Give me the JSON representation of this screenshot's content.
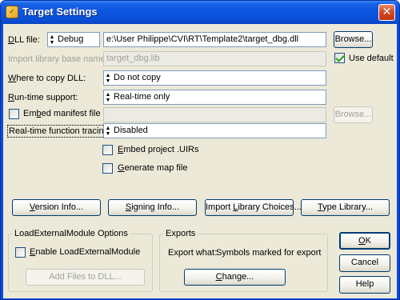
{
  "window": {
    "title": "Target Settings",
    "icon": "cvi-app-icon",
    "close_glyph": "✕",
    "colors": {
      "titlebar": "#0a55e0",
      "client": "#ece9d8",
      "check": "#21a121"
    }
  },
  "dll_file": {
    "label_prefix": "D",
    "label_rest": "LL file:",
    "config_value": "Debug",
    "path_value": "e:\\User Philippe\\CVI\\RT\\Template2\\target_dbg.dll",
    "browse_label": "Browse..."
  },
  "import_library": {
    "label": "Import library base name:",
    "value": "target_dbg.lib",
    "use_default_label": "Use default",
    "use_default_checked": true
  },
  "where_to_copy": {
    "label_prefix": "W",
    "label_rest": "here to copy DLL:",
    "value": "Do not copy"
  },
  "runtime_support": {
    "label_prefix": "R",
    "label_rest": "un-time support:",
    "value": "Real-time only"
  },
  "embed_manifest": {
    "label_pre": "Em",
    "label_u": "b",
    "label_post": "ed manifest file",
    "checked": false,
    "path_value": "",
    "browse_label": "Browse..."
  },
  "function_tracing": {
    "label": "Real-time function tracing:",
    "value": "Disabled"
  },
  "embed_uirs": {
    "label_prefix": "E",
    "label_rest": "mbed project .UIRs",
    "checked": false
  },
  "generate_map": {
    "label_prefix": "G",
    "label_rest": "enerate map file",
    "checked": false
  },
  "action_buttons": {
    "version_prefix": "V",
    "version_rest": "ersion Info...",
    "signing_prefix": "S",
    "signing_rest": "igning Info...",
    "import_pre": "Import ",
    "import_u": "L",
    "import_post": "ibrary Choices...",
    "type_prefix": "T",
    "type_rest": "ype Library..."
  },
  "load_external": {
    "group_title": "LoadExternalModule Options",
    "enable_pre": "E",
    "enable_rest": "nable LoadExternalModule",
    "enable_checked": false,
    "add_files_label": "Add Files to DLL..."
  },
  "exports": {
    "group_title": "Exports",
    "export_what_label": "Export what:",
    "export_what_value": "Symbols marked for export",
    "change_prefix": "C",
    "change_rest": "hange..."
  },
  "dialog_buttons": {
    "ok_prefix": "O",
    "ok_rest": "K",
    "cancel_label": "Cancel",
    "help_label": "Help"
  }
}
